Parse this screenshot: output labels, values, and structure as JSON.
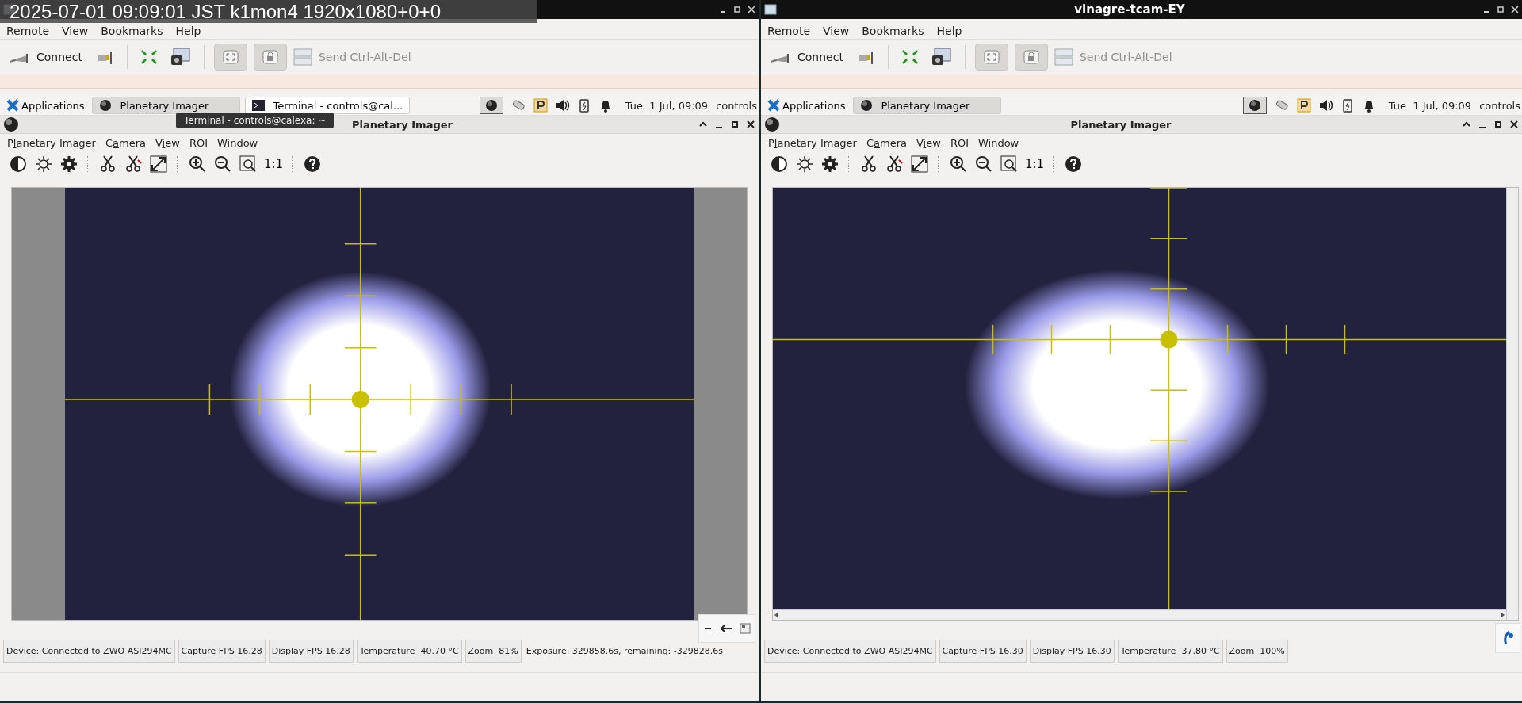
{
  "overlay": {
    "text": "2025-07-01 09:09:01 JST k1mon4 1920x1080+0+0"
  },
  "panes": [
    {
      "menu": [
        "Remote",
        "View",
        "Bookmarks",
        "Help"
      ],
      "connect_label": "Connect",
      "toggles": [
        {
          "kind": "scale",
          "on": true
        },
        {
          "kind": "lock",
          "on": true
        }
      ],
      "ctrl_alt_del": "Send Ctrl-Alt-Del",
      "taskbar": {
        "applications": "Applications",
        "tasks": [
          {
            "label": "Planetary Imager",
            "kind": "app",
            "selected": true
          },
          {
            "label": "Terminal - controls@cal...",
            "kind": "terminal",
            "selected": false
          }
        ],
        "clock": "Tue  1 Jul, 09:09",
        "user": "controls"
      },
      "tooltip": "Terminal - controls@calexa: ~",
      "app": {
        "title": "Planetary Imager",
        "menu": [
          {
            "label": "Planetary Imager",
            "underlined": true
          },
          {
            "label": "Camera",
            "underlined": true
          },
          {
            "label": "View",
            "underlined": true
          },
          {
            "label": "ROI",
            "underlined": false
          },
          {
            "label": "Window",
            "underlined": false
          }
        ],
        "zoom_label": "1:1",
        "kind": "fit",
        "status": [
          "Device: Connected to ZWO ASI294MC",
          "Capture FPS 16.28",
          "Display FPS 16.28",
          "Temperature  40.70 °C",
          "Zoom  81%"
        ],
        "exposure": "Exposure: 329858.6s, remaining: -329828.6s"
      }
    },
    {
      "title": "vinagre-tcam-EY",
      "menu": [
        "Remote",
        "View",
        "Bookmarks",
        "Help"
      ],
      "connect_label": "Connect",
      "toggles": [
        {
          "kind": "scale",
          "on": true
        },
        {
          "kind": "lock",
          "on": true
        }
      ],
      "ctrl_alt_del": "Send Ctrl-Alt-Del",
      "taskbar": {
        "applications": "Applications",
        "tasks": [
          {
            "label": "Planetary Imager",
            "kind": "app",
            "selected": true
          }
        ],
        "clock": "Tue  1 Jul, 09:09",
        "user": "controls"
      },
      "app": {
        "title": "Planetary Imager",
        "menu": [
          {
            "label": "Planetary Imager",
            "underlined": true
          },
          {
            "label": "Camera",
            "underlined": true
          },
          {
            "label": "View",
            "underlined": true
          },
          {
            "label": "ROI",
            "underlined": false
          },
          {
            "label": "Window",
            "underlined": false
          }
        ],
        "zoom_label": "1:1",
        "kind": "actual",
        "status": [
          "Device: Connected to ZWO ASI294MC",
          "Capture FPS 16.30",
          "Display FPS 16.30",
          "Temperature  37.80 °C",
          "Zoom  100%"
        ]
      }
    }
  ]
}
